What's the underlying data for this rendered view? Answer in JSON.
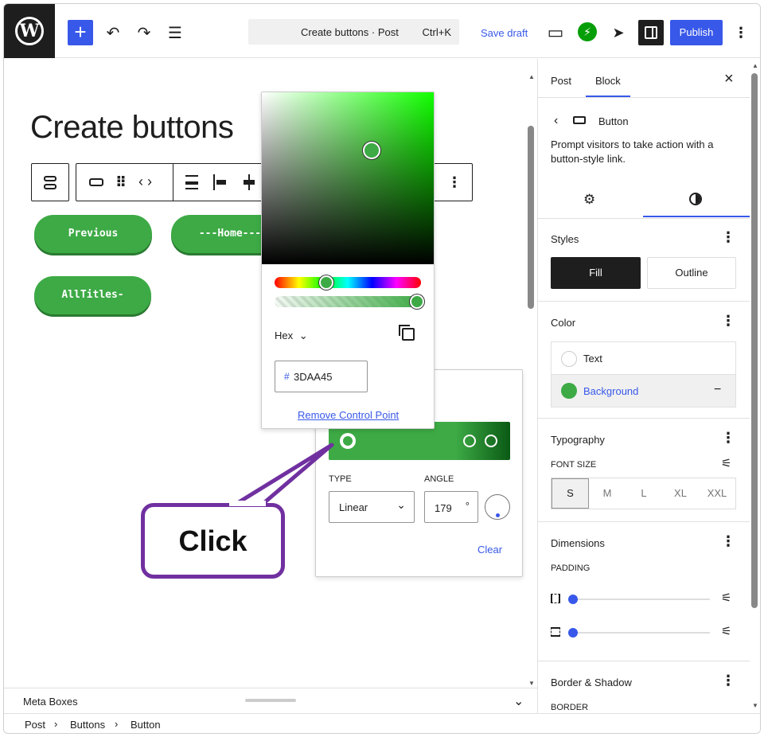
{
  "topbar": {
    "wp_logo": "W",
    "add": "+",
    "undo": "↶",
    "redo": "↷",
    "list_view": "☰",
    "command": {
      "title": "Create buttons · Post",
      "shortcut": "Ctrl+K"
    },
    "save_draft": "Save draft",
    "view_icon": "▭",
    "jetpack": "⚡",
    "send": "➤",
    "publish": "Publish",
    "more": "⋮"
  },
  "editor": {
    "title": "Create buttons",
    "buttons": [
      "Previous",
      "---Home---",
      "AllTitles-"
    ],
    "meta_boxes": "Meta Boxes"
  },
  "breadcrumb": {
    "items": [
      "Post",
      "Buttons",
      "Button"
    ],
    "sep": "›"
  },
  "color_picker": {
    "format": "Hex",
    "hex_prefix": "#",
    "hex_value": "3DAA45",
    "remove_link": "Remove Control Point"
  },
  "gradient": {
    "type_label": "TYPE",
    "type_value": "Linear",
    "angle_label": "ANGLE",
    "angle_value": "179",
    "angle_unit": "°",
    "clear": "Clear"
  },
  "callout": {
    "text": "Click"
  },
  "sidebar": {
    "tabs": [
      "Post",
      "Block"
    ],
    "close": "×",
    "block": {
      "name": "Button",
      "description": "Prompt visitors to take action with a button-style link."
    },
    "styles": {
      "title": "Styles",
      "options": [
        "Fill",
        "Outline"
      ]
    },
    "color": {
      "title": "Color",
      "items": [
        "Text",
        "Background"
      ],
      "remove": "−"
    },
    "typography": {
      "title": "Typography",
      "font_size_label": "FONT SIZE",
      "sizes": [
        "S",
        "M",
        "L",
        "XL",
        "XXL"
      ]
    },
    "dimensions": {
      "title": "Dimensions",
      "padding_label": "PADDING"
    },
    "border": {
      "title": "Border & Shadow",
      "border_label": "BORDER"
    }
  },
  "colors": {
    "accent": "#3858e9",
    "button_green": "#3daa45",
    "callout_purple": "#7030a0"
  }
}
